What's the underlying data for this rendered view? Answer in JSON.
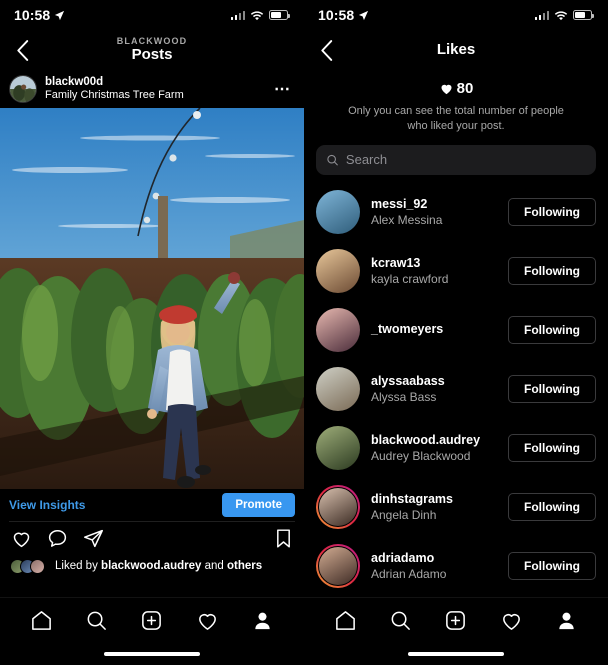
{
  "status_bar": {
    "time": "10:58",
    "location_icon": "location-arrow-icon",
    "signal_icon": "cellular-signal-icon",
    "wifi_icon": "wifi-icon",
    "battery_icon": "battery-icon"
  },
  "left_screen": {
    "nav": {
      "back_icon": "chevron-left-icon",
      "eyebrow": "BLACKWOOD",
      "title": "Posts"
    },
    "post": {
      "username": "blackw00d",
      "subtitle": "Family Christmas Tree Farm",
      "more_icon": "more-options-icon",
      "image_alt": "woman in denim jacket and red beanie raising arm at christmas tree farm",
      "view_insights_label": "View Insights",
      "promote_label": "Promote",
      "like_icon": "heart-icon",
      "comment_icon": "comment-bubble-icon",
      "share_icon": "share-paper-plane-icon",
      "save_icon": "bookmark-icon",
      "liked_by_prefix": "Liked by",
      "liked_by_user": "blackwood.audrey",
      "liked_by_middle": "and",
      "liked_by_suffix": "others"
    }
  },
  "right_screen": {
    "nav": {
      "back_icon": "chevron-left-icon",
      "title": "Likes"
    },
    "like_count": "80",
    "like_count_icon": "heart-filled-icon",
    "privacy_note": "Only you can see the total number of people who liked your post.",
    "search": {
      "icon": "search-icon",
      "placeholder": "Search",
      "value": ""
    },
    "likers": [
      {
        "username": "messi_92",
        "fullname": "Alex Messina",
        "button": "Following",
        "has_story_ring": false,
        "avatar_colors": [
          "#7fb5d8",
          "#2f5d7a"
        ]
      },
      {
        "username": "kcraw13",
        "fullname": "kayla crawford",
        "button": "Following",
        "has_story_ring": false,
        "avatar_colors": [
          "#e8c79a",
          "#6b4a33"
        ]
      },
      {
        "username": "_twomeyers",
        "fullname": "",
        "button": "Following",
        "has_story_ring": false,
        "avatar_colors": [
          "#e8b9b0",
          "#4a2c3a"
        ]
      },
      {
        "username": "alyssaabass",
        "fullname": "Alyssa Bass",
        "button": "Following",
        "has_story_ring": false,
        "avatar_colors": [
          "#cfd0c6",
          "#7a6a55"
        ]
      },
      {
        "username": "blackwood.audrey",
        "fullname": "Audrey Blackwood",
        "button": "Following",
        "has_story_ring": false,
        "avatar_colors": [
          "#9fae7a",
          "#2b3a20"
        ]
      },
      {
        "username": "dinhstagrams",
        "fullname": "Angela Dinh",
        "button": "Following",
        "has_story_ring": true,
        "avatar_colors": [
          "#d8c0ae",
          "#3a2a22"
        ]
      },
      {
        "username": "adriadamo",
        "fullname": "Adrian Adamo",
        "button": "Following",
        "has_story_ring": true,
        "avatar_colors": [
          "#d2ac92",
          "#3d2a24"
        ]
      }
    ]
  },
  "tab_bar": {
    "items": [
      {
        "icon": "home-icon",
        "label": "Home"
      },
      {
        "icon": "search-icon",
        "label": "Search"
      },
      {
        "icon": "add-post-icon",
        "label": "New Post"
      },
      {
        "icon": "activity-heart-icon",
        "label": "Activity"
      },
      {
        "icon": "profile-person-icon",
        "label": "Profile"
      }
    ]
  },
  "colors": {
    "accent_blue": "#3897f0",
    "link_blue": "#3f9ae8",
    "background": "#000000",
    "secondary_text": "#a8a8a8",
    "search_bg": "#1c1c1e"
  }
}
